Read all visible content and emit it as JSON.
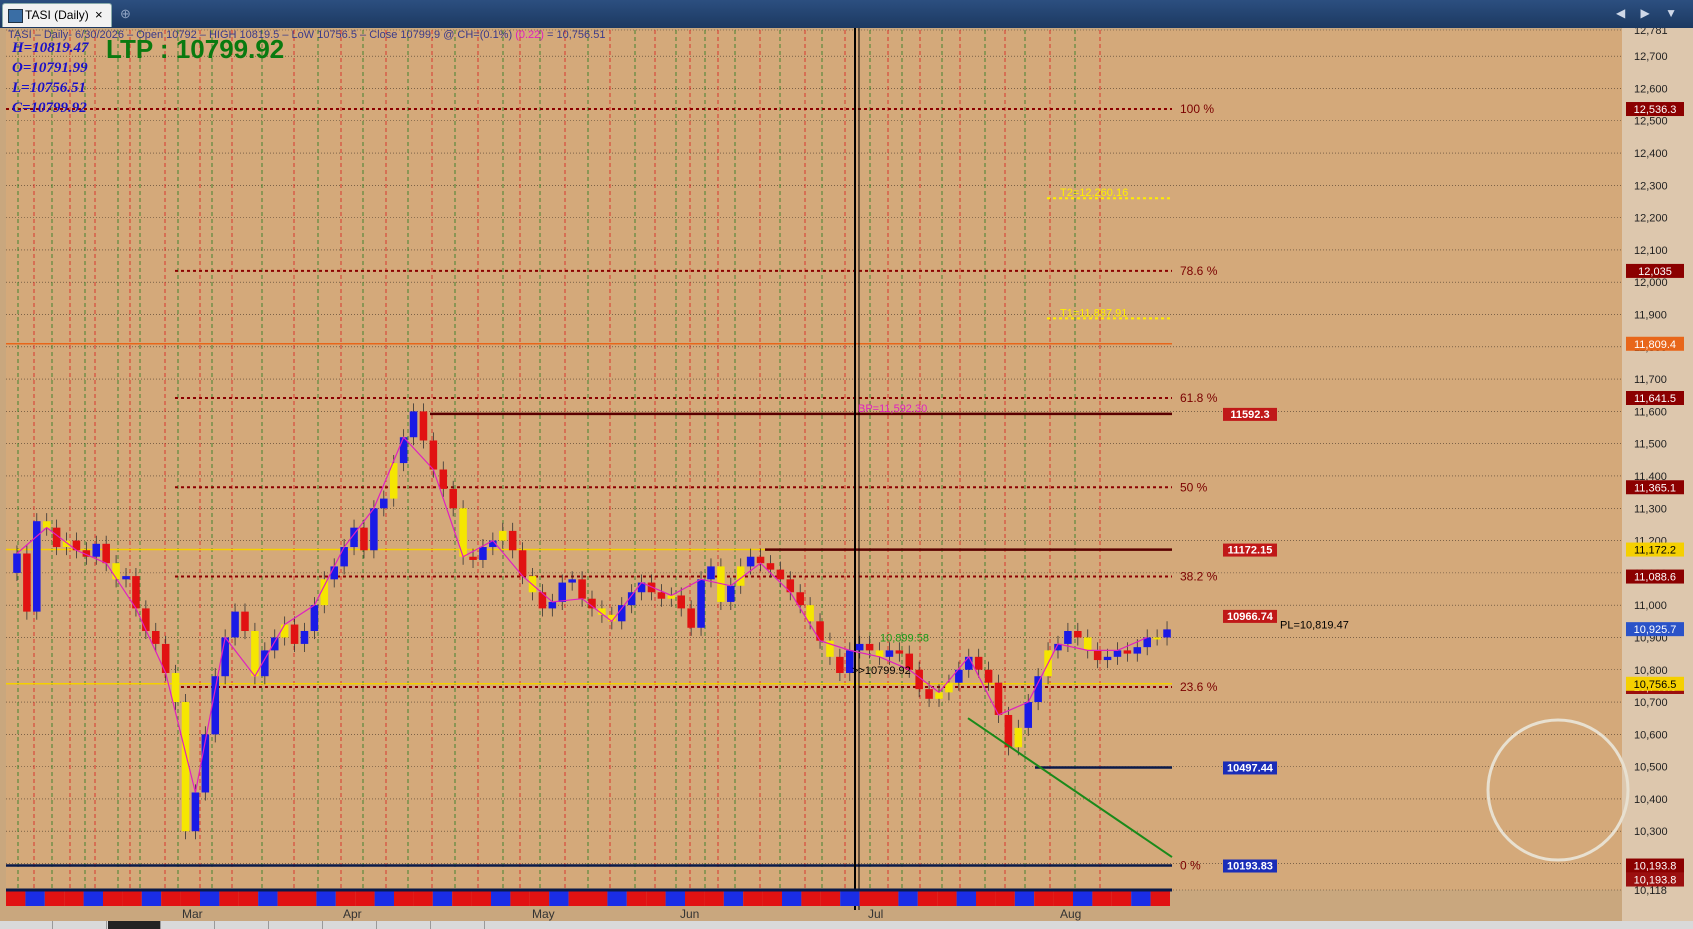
{
  "window": {
    "tab_title": "TASI (Daily)",
    "tab_close": "×",
    "pin_glyph": "⊕",
    "nav_glyphs": "◀ ▶ ▼"
  },
  "header": {
    "info_line": "TASI – Daily- 6/30/2026 – Open 10792 – HIGH 10819.5 – LoW 10756.5 – Close 10799.9 @ CH=(0.1%)",
    "info_change": "(0.22)",
    "info_tail": "= 10,756.51",
    "high": "H=10819.47",
    "open": "O=10791.99",
    "low": "L=10756.51",
    "close": "C=10799.92",
    "ltp": "LTP : 10799.92"
  },
  "chart_data": {
    "type": "candlestick",
    "instrument": "TASI",
    "interval": "Daily",
    "ylim": [
      10118,
      12781
    ],
    "y_ticks": [
      10118,
      10200,
      10300,
      10400,
      10500,
      10600,
      10700,
      10800,
      10900,
      11000,
      11100,
      11200,
      11300,
      11400,
      11500,
      11600,
      11700,
      11800,
      11900,
      12000,
      12100,
      12200,
      12300,
      12400,
      12500,
      12600,
      12700,
      12781
    ],
    "y_tick_labels": [
      "10,118",
      "10,200",
      "10,300",
      "10,400",
      "10,500",
      "10,600",
      "10,700",
      "10,800",
      "10,900",
      "11,000",
      "11,100",
      "11,200",
      "11,300",
      "11,400",
      "11,500",
      "11,600",
      "11,700",
      "11,800",
      "11,900",
      "12,000",
      "12,100",
      "12,200",
      "12,300",
      "12,400",
      "12,500",
      "12,600",
      "12,700",
      "12,781"
    ],
    "months": [
      "Mar",
      "Apr",
      "May",
      "Jun",
      "Jul",
      "Aug"
    ],
    "close": [
      11160,
      10980,
      11260,
      11240,
      11180,
      11200,
      11170,
      11150,
      11190,
      11130,
      11080,
      11090,
      10990,
      10920,
      10880,
      10790,
      10700,
      10300,
      10420,
      10600,
      10780,
      10900,
      10980,
      10920,
      10780,
      10860,
      10900,
      10940,
      10880,
      10920,
      11000,
      11080,
      11120,
      11180,
      11240,
      11170,
      11300,
      11330,
      11440,
      11520,
      11600,
      11510,
      11420,
      11360,
      11300,
      11150,
      11140,
      11180,
      11200,
      11230,
      11170,
      11090,
      11040,
      10990,
      11010,
      11070,
      11080,
      11020,
      10990,
      10970,
      10950,
      11000,
      11040,
      11070,
      11040,
      11020,
      11030,
      10990,
      10930,
      11080,
      11120,
      11010,
      11060,
      11120,
      11150,
      11130,
      11110,
      11080,
      11040,
      11000,
      10950,
      10890,
      10840,
      10790,
      10860,
      10880,
      10860,
      10840,
      10860,
      10850,
      10800,
      10740,
      10710,
      10730,
      10760,
      10800,
      10840,
      10800,
      10760,
      10660,
      10560,
      10620,
      10700,
      10780,
      10860,
      10880,
      10920,
      10900,
      10860,
      10830,
      10840,
      10860,
      10850,
      10870,
      10900,
      10900,
      10925
    ],
    "fib_levels": [
      {
        "label": "100 %",
        "price": "12,536.3"
      },
      {
        "label": "78.6 %",
        "price": "12,035"
      },
      {
        "label": "61.8 %",
        "price": "11,641.5"
      },
      {
        "label": "50 %",
        "price": "11,365.1"
      },
      {
        "label": "38.2 %",
        "price": "11,088.6"
      },
      {
        "label": "23.6 %",
        "price": "10,746.6"
      },
      {
        "label": "0 %",
        "price": "10,193.8"
      }
    ],
    "targets": [
      {
        "label": "T2=12,260.16",
        "price": 12260.16
      },
      {
        "label": "T1=11,887.91",
        "price": 11887.91
      }
    ],
    "level_boxes": [
      {
        "label": "11592.3",
        "price": 11592.3
      },
      {
        "label": "11172.15",
        "price": 11172.15
      },
      {
        "label": "10966.74",
        "price": 10966.74
      },
      {
        "label": "10497.44",
        "price": 10497.44
      },
      {
        "label": "10193.83",
        "price": 10193.83
      }
    ],
    "other_levels": [
      {
        "price": "11,809.4",
        "color": "#e8661a"
      },
      {
        "price": "11,172.2",
        "color": "#f5d000"
      },
      {
        "price": "10,925.7",
        "color": "#2a52c8"
      },
      {
        "price": "10,756.5",
        "color": "#f5d000"
      },
      {
        "price": "10,193.8",
        "color": "#9b0f0f"
      }
    ],
    "bp_label": "BP=11,592.30",
    "marker_label": ">>10799.92",
    "green_label": "10,899.58",
    "pivot_label": "PL=10,819.47"
  },
  "colors": {
    "background": "#d4a97a",
    "up": "#1a1ae6",
    "down": "#e11212",
    "neutral": "#f5e600",
    "fib": "#8b0000",
    "zigzag": "#e020c0"
  }
}
